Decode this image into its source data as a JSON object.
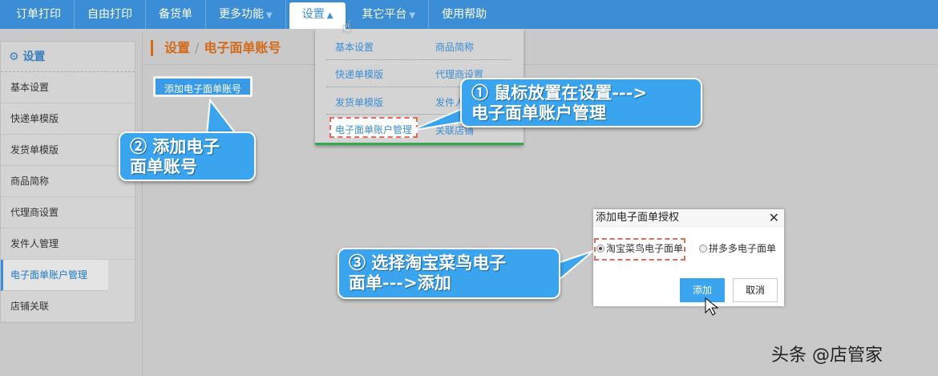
{
  "nav": {
    "items": [
      {
        "label": "订单打印"
      },
      {
        "label": "自由打印"
      },
      {
        "label": "备货单"
      },
      {
        "label": "更多功能",
        "caret": "▼"
      },
      {
        "label": "设置",
        "caret": "▲",
        "active": true
      },
      {
        "label": "其它平台",
        "caret": "▼"
      },
      {
        "label": "使用帮助"
      }
    ]
  },
  "sidebar": {
    "title": "设置",
    "icon": "gear-icon",
    "items": [
      "基本设置",
      "快递单模版",
      "发货单模版",
      "商品简称",
      "代理商设置",
      "发件人管理",
      "电子面单账户管理",
      "店铺关联"
    ],
    "selected_index": 6
  },
  "breadcrumb": {
    "root": "设置",
    "sep": "/",
    "current": "电子面单账号"
  },
  "add_account_button": "添加电子面单账号",
  "dropdown": {
    "left": [
      "基本设置",
      "快递单模版",
      "发货单模版",
      "电子面单账户管理"
    ],
    "right": [
      "商品简称",
      "代理商设置",
      "发件人管理",
      "关联店铺"
    ]
  },
  "callouts": {
    "c1_line1": "① 鼠标放置在设置--->",
    "c1_line2": "电子面单账户管理",
    "c2_line1": "② 添加电子",
    "c2_line2": "面单账号",
    "c3_line1": "③ 选择淘宝菜鸟电子",
    "c3_line2": "面单--->添加"
  },
  "dialog": {
    "title": "添加电子面单授权",
    "close": "✕",
    "option1": "淘宝菜鸟电子面单",
    "option2": "拼多多电子面单",
    "selected": "淘宝菜鸟电子面单",
    "add": "添加",
    "cancel": "取消"
  },
  "watermark": "头条 @店管家",
  "colors": {
    "nav": "#3b8ed5",
    "callout": "#3aa5ee",
    "highlight": "#e8695a",
    "breadcrumb": "#d36a1a"
  }
}
